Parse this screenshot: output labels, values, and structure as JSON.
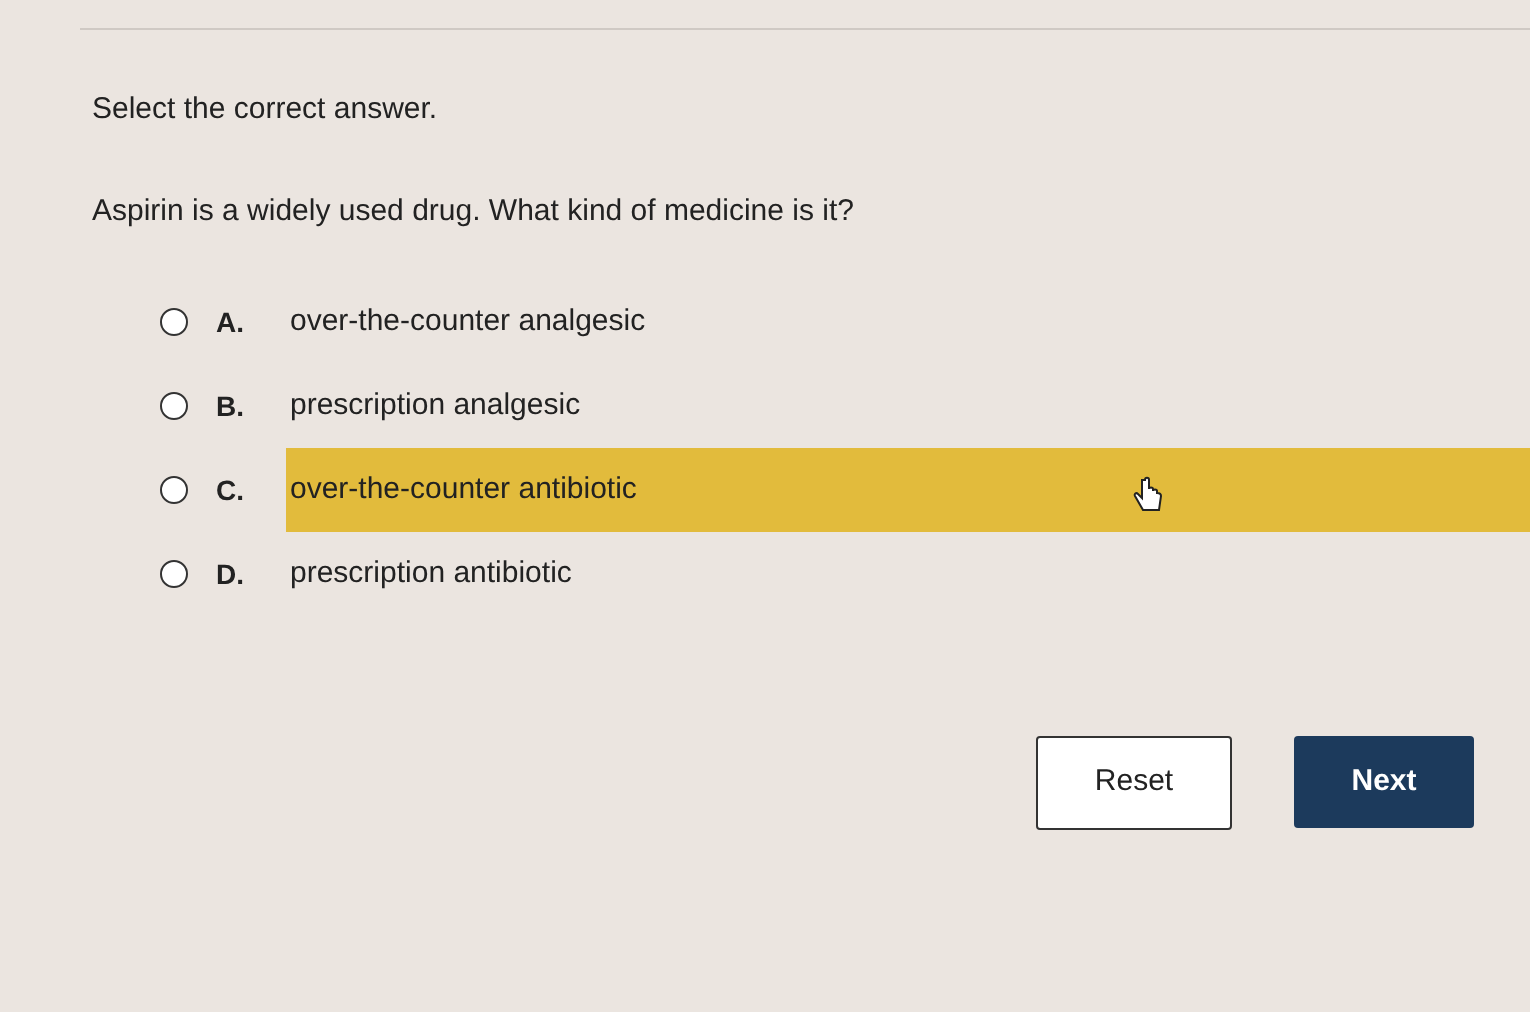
{
  "instruction": "Select the correct answer.",
  "question": "Aspirin is a widely used drug. What kind of medicine is it?",
  "options": [
    {
      "letter": "A.",
      "text": "over-the-counter analgesic",
      "selected": false,
      "highlighted": false
    },
    {
      "letter": "B.",
      "text": "prescription analgesic",
      "selected": false,
      "highlighted": false
    },
    {
      "letter": "C.",
      "text": "over-the-counter antibiotic",
      "selected": false,
      "highlighted": true
    },
    {
      "letter": "D.",
      "text": "prescription antibiotic",
      "selected": false,
      "highlighted": false
    }
  ],
  "buttons": [
    {
      "label": "Reset",
      "kind": "secondary"
    },
    {
      "label": "Next",
      "kind": "primary"
    }
  ]
}
